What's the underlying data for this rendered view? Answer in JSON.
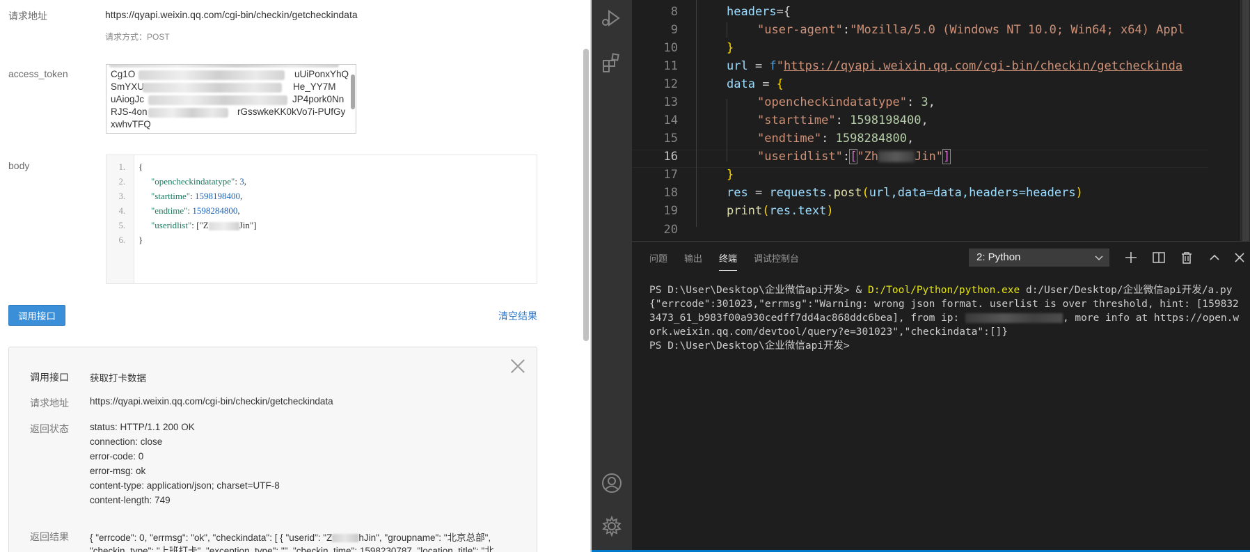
{
  "api_tool": {
    "labels": {
      "request_url": "请求地址",
      "access_token": "access_token",
      "body": "body"
    },
    "request_url": "https://qyapi.weixin.qq.com/cgi-bin/checkin/getcheckindata",
    "request_method": "请求方式：POST",
    "token_lines": [
      "Cg1O",
      "uUiPonxYhQ",
      "SmYXU",
      "He_YY7M",
      "uAiogJc",
      "JP4pork0Nn",
      "RJS-4on",
      "rGsswkeKK0kVo7i-PUfGy",
      "xwhvTFQ"
    ],
    "body_line_numbers": [
      "1.",
      "2.",
      "3.",
      "4.",
      "5.",
      "6."
    ],
    "body": {
      "open_brace": "{",
      "k1": "\"opencheckindatatype\"",
      "v1": "3",
      "k2": "\"starttime\"",
      "v2": "1598198400",
      "k3": "\"endtime\"",
      "v3": "1598284800",
      "k4": "\"useridlist\"",
      "v4_prefix": "[\"Z",
      "v4_suffix": "Jin\"]",
      "close_brace": "}"
    },
    "call_button": "调用接口",
    "clear_link": "清空结果",
    "result": {
      "api_label": "调用接口",
      "api_name": "获取打卡数据",
      "url_label": "请求地址",
      "url": "https://qyapi.weixin.qq.com/cgi-bin/checkin/getcheckindata",
      "status_label": "返回状态",
      "status_lines": [
        "status: HTTP/1.1 200 OK",
        "connection: close",
        "error-code: 0",
        "error-msg: ok",
        "content-type: application/json; charset=UTF-8",
        "content-length: 749"
      ],
      "result_label": "返回结果",
      "result_line1_a": "{ \"errcode\": 0, \"errmsg\": \"ok\", \"checkindata\": [ { \"userid\": \"Z",
      "result_line1_b": "hJin\", \"groupname\": \"北京总部\",",
      "result_line2": "\"checkin_type\": \"上班打卡\", \"exception_type\": \"\", \"checkin_time\": 1598230787, \"location_title\": \"北"
    }
  },
  "vscode": {
    "line_numbers": [
      "8",
      "9",
      "10",
      "11",
      "12",
      "13",
      "14",
      "15",
      "16",
      "17",
      "18",
      "19",
      "20"
    ],
    "code": {
      "l8_var": "headers",
      "l8_rest": "={",
      "l9_key": "\"user-agent\"",
      "l9_colon": ":",
      "l9_val": "\"Mozilla/5.0 (Windows NT 10.0; Win64; x64) Appl",
      "l10": "}",
      "l11_var": "url",
      "l11_eq": " = ",
      "l11_f": "f",
      "l11_q": "\"",
      "l11_url": "https://qyapi.weixin.qq.com/cgi-bin/checkin/getcheckinda",
      "l12_var": "data",
      "l12_eq": " = ",
      "l12_brace": "{",
      "l13_key": "\"opencheckindatatype\"",
      "l13_sep": ": ",
      "l13_val": "3",
      "l13_end": ",",
      "l14_key": "\"starttime\"",
      "l14_sep": ": ",
      "l14_val": "1598198400",
      "l14_end": ",",
      "l15_key": "\"endtime\"",
      "l15_sep": ": ",
      "l15_val": "1598284800",
      "l15_end": ",",
      "l16_key": "\"useridlist\"",
      "l16_sep": ":",
      "l16_open": "[",
      "l16_v1": "\"Zh",
      "l16_v2": "Jin\"",
      "l16_close": "]",
      "l17": "}",
      "l18_var": "res",
      "l18_eq": " = ",
      "l18_obj": "requests",
      "l18_dot": ".",
      "l18_fn": "post",
      "l18_open": "(",
      "l18_args": "url,data=data,headers=headers",
      "l18_close": ")",
      "l19_fn": "print",
      "l19_open": "(",
      "l19_args": "res.text",
      "l19_close": ")"
    },
    "panel_tabs": [
      "问题",
      "输出",
      "终端",
      "调试控制台"
    ],
    "terminal_select": "2: Python",
    "terminal": {
      "prompt1": "PS D:\\User\\Desktop\\企业微信api开发> & ",
      "python_path": "D:/Tool/Python/python.exe",
      "script_path": " d:/User/Desktop/企业微信api开发/a.py",
      "output_a": "{\"errcode\":301023,\"errmsg\":\"Warning: wrong json format. userlist is over threshold, hint: [1598323473_61_b983f00a930cedff7dd4ac868ddc6bea], from ip: ",
      "output_b": ", more info at https://open.work.weixin.qq.com/devtool/query?e=301023\",\"checkindata\":[]}",
      "prompt2": "PS D:\\User\\Desktop\\企业微信api开发>"
    },
    "colors": {
      "background": "#1e1e1e",
      "activity_bar": "#333333",
      "string": "#ce9178",
      "number": "#b5cea8",
      "variable": "#9cdcfe",
      "accent": "#007acc"
    },
    "icons": [
      "run-debug-icon",
      "extensions-icon",
      "account-icon",
      "settings-gear-icon",
      "plus-icon",
      "split-icon",
      "trash-icon",
      "chevron-up-icon",
      "close-icon",
      "chevron-down-icon"
    ]
  }
}
